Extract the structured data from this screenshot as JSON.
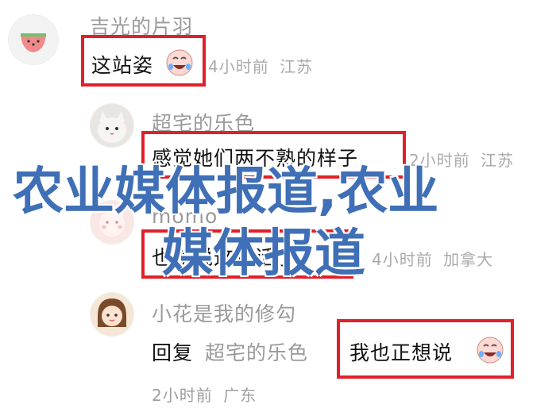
{
  "comments": [
    {
      "username": "吉光的片羽",
      "text": "这站姿",
      "time": "4小时前",
      "location": "江苏"
    },
    {
      "username": "超宅的乐色",
      "text": "感觉她们两不熟的样子",
      "time": "2小时前",
      "location": "江苏"
    },
    {
      "username": "momo",
      "text": "也就说这句话了",
      "time": "4小时前",
      "location": "加拿大"
    },
    {
      "username": "小花是我的修勾",
      "reply_word": "回复",
      "reply_to": "超宅的乐色",
      "text": "我也正想说",
      "time": "2小时前",
      "location": "广东"
    }
  ],
  "overlay": {
    "line1": "农业媒体报道,农业",
    "line2": "媒体报道"
  },
  "colors": {
    "highlight": "#e0202a",
    "overlay": "#3f6fb6"
  }
}
